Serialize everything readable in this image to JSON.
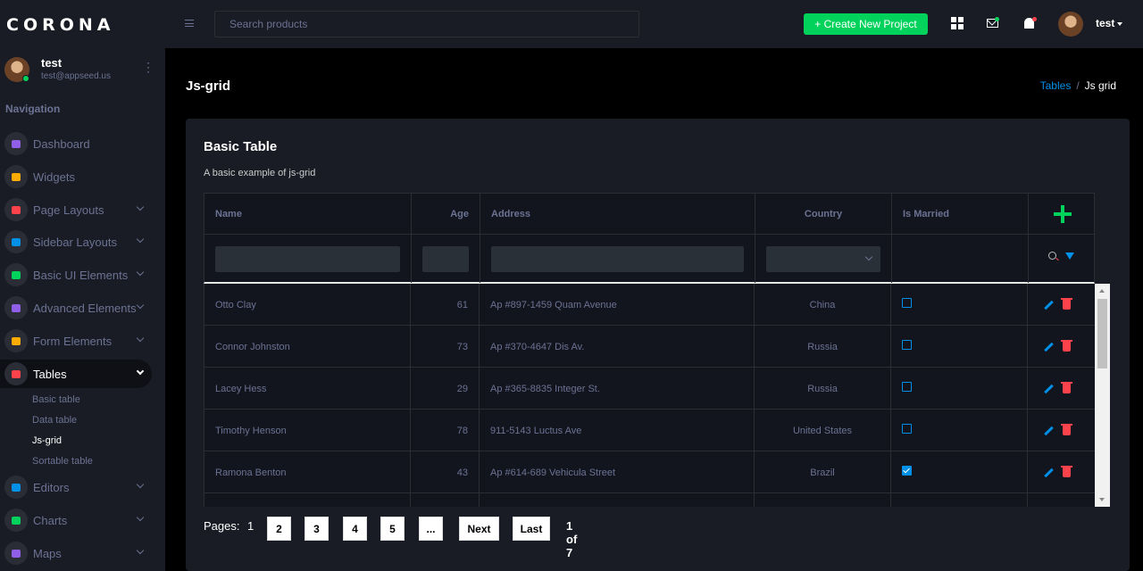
{
  "brand": "CORONA",
  "profile": {
    "name": "test",
    "email": "test@appseed.us"
  },
  "nav_title": "Navigation",
  "nav": [
    {
      "label": "Dashboard",
      "color": "#8f5fe8",
      "arrow": false
    },
    {
      "label": "Widgets",
      "color": "#ffab00",
      "arrow": false
    },
    {
      "label": "Page Layouts",
      "color": "#fc424a",
      "arrow": true
    },
    {
      "label": "Sidebar Layouts",
      "color": "#0090e7",
      "arrow": true
    },
    {
      "label": "Basic UI Elements",
      "color": "#00d25b",
      "arrow": true
    },
    {
      "label": "Advanced Elements",
      "color": "#8f5fe8",
      "arrow": true
    },
    {
      "label": "Form Elements",
      "color": "#ffab00",
      "arrow": true
    },
    {
      "label": "Tables",
      "color": "#fc424a",
      "arrow": true,
      "active": true
    },
    {
      "label": "Editors",
      "color": "#0090e7",
      "arrow": true
    },
    {
      "label": "Charts",
      "color": "#00d25b",
      "arrow": true
    },
    {
      "label": "Maps",
      "color": "#8f5fe8",
      "arrow": true
    }
  ],
  "sub_nav": [
    "Basic table",
    "Data table",
    "Js-grid",
    "Sortable table"
  ],
  "topbar": {
    "search_placeholder": "Search products",
    "create_label": "+ Create New Project",
    "user": "test"
  },
  "page": {
    "title": "Js-grid"
  },
  "breadcrumb": {
    "parent": "Tables",
    "sep": "/",
    "current": "Js grid"
  },
  "card": {
    "title": "Basic Table",
    "description": "A basic example of js-grid"
  },
  "columns": [
    "Name",
    "Age",
    "Address",
    "Country",
    "Is Married"
  ],
  "rows": [
    {
      "name": "Otto Clay",
      "age": "61",
      "address": "Ap #897-1459 Quam Avenue",
      "country": "China",
      "married": false
    },
    {
      "name": "Connor Johnston",
      "age": "73",
      "address": "Ap #370-4647 Dis Av.",
      "country": "Russia",
      "married": false
    },
    {
      "name": "Lacey Hess",
      "age": "29",
      "address": "Ap #365-8835 Integer St.",
      "country": "Russia",
      "married": false
    },
    {
      "name": "Timothy Henson",
      "age": "78",
      "address": "911-5143 Luctus Ave",
      "country": "United States",
      "married": false
    },
    {
      "name": "Ramona Benton",
      "age": "43",
      "address": "Ap #614-689 Vehicula Street",
      "country": "Brazil",
      "married": true
    },
    {
      "name": "",
      "age": "",
      "address": "",
      "country": "",
      "married": true
    }
  ],
  "pager": {
    "label": "Pages:",
    "current": "1",
    "pages": [
      "2",
      "3",
      "4",
      "5",
      "..."
    ],
    "next": "Next",
    "last": "Last",
    "info": "1 of 7"
  },
  "colors": {
    "accent_green": "#00d25b",
    "accent_blue": "#0090e7",
    "danger": "#fc424a",
    "sidebar_bg": "#191c24",
    "muted_text": "#6c7293"
  }
}
